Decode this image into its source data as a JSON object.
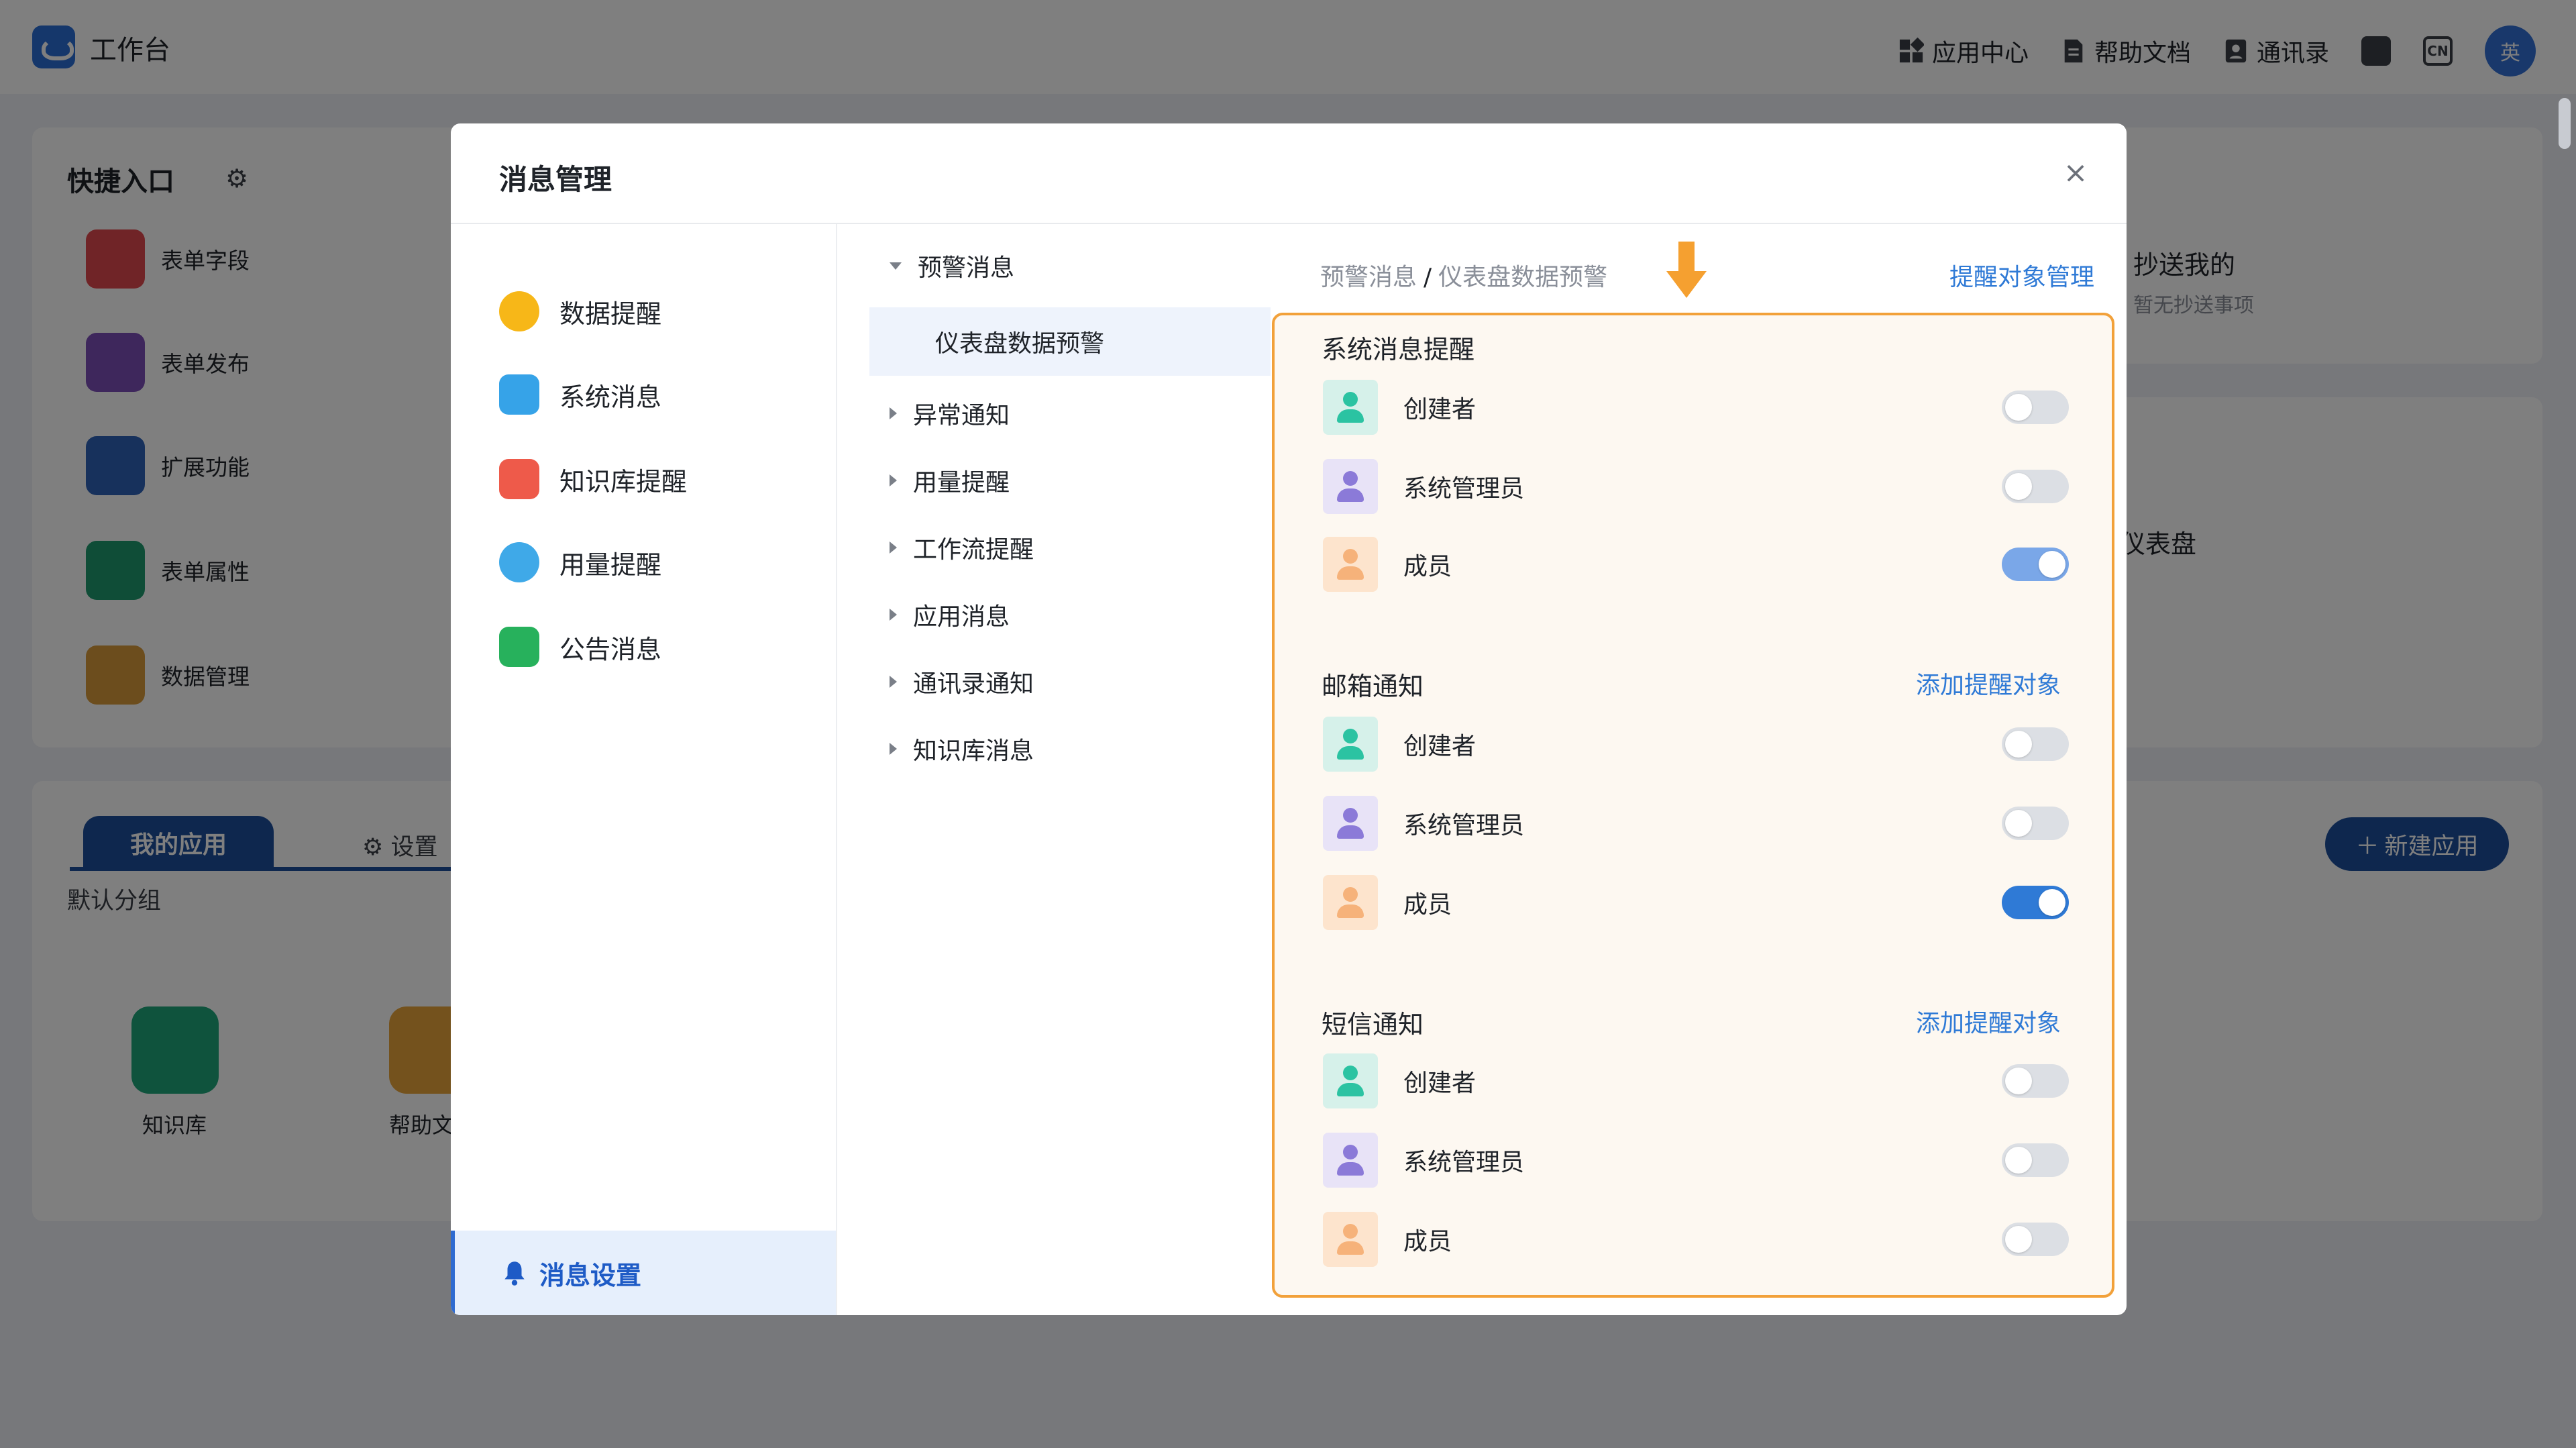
{
  "app": {
    "title": "工作台",
    "nav": {
      "app_center": "应用中心",
      "help_docs": "帮助文档",
      "contacts": "通讯录",
      "lang_badge": "CN",
      "user_initial": "英"
    }
  },
  "background": {
    "quick_entry_title": "快捷入口",
    "quick_items": [
      "表单字段",
      "表单发布",
      "扩展功能",
      "表单属性",
      "数据管理"
    ],
    "cc_me_title": "抄送我的",
    "cc_me_empty": "暂无抄送事项",
    "dashboard_partial": "仪表盘",
    "my_apps_tab": "我的应用",
    "settings_tab": "设置",
    "default_group": "默认分组",
    "apps": [
      "知识库",
      "帮助文"
    ],
    "new_app_button": "新建应用"
  },
  "modal": {
    "title": "消息管理",
    "left_nav": [
      "数据提醒",
      "系统消息",
      "知识库提醒",
      "用量提醒",
      "公告消息"
    ],
    "settings_item": "消息设置",
    "tree": {
      "expanded": "预警消息",
      "selected_child": "仪表盘数据预警",
      "collapsed": [
        "异常通知",
        "用量提醒",
        "工作流提醒",
        "应用消息",
        "通讯录通知",
        "知识库消息"
      ]
    },
    "breadcrumb": {
      "parent": "预警消息",
      "separator": "/",
      "current": "仪表盘数据预警"
    },
    "manage_link": "提醒对象管理",
    "sections": [
      {
        "title": "系统消息提醒",
        "link": "",
        "rows": [
          {
            "label": "创建者",
            "on": false
          },
          {
            "label": "系统管理员",
            "on": false
          },
          {
            "label": "成员",
            "on": true
          }
        ]
      },
      {
        "title": "邮箱通知",
        "link": "添加提醒对象",
        "rows": [
          {
            "label": "创建者",
            "on": false
          },
          {
            "label": "系统管理员",
            "on": false
          },
          {
            "label": "成员",
            "on": true
          }
        ]
      },
      {
        "title": "短信通知",
        "link": "添加提醒对象",
        "rows": [
          {
            "label": "创建者",
            "on": false
          },
          {
            "label": "系统管理员",
            "on": false
          },
          {
            "label": "成员",
            "on": false
          }
        ]
      }
    ]
  },
  "colors": {
    "accent": "#2f7ad6",
    "highlight_border": "#f2a13a",
    "arrow": "#f5a030"
  }
}
